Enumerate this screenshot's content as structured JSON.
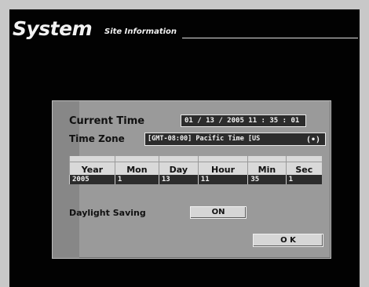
{
  "header": {
    "title": "System",
    "subtitle": "Site Information"
  },
  "dialog": {
    "current_time_label": "Current Time",
    "current_time_value": "01 / 13 / 2005  11 : 35 : 01",
    "time_zone_label": "Time Zone",
    "time_zone_value": "[GMT-08:00] Pacific Time [US",
    "time_zone_selector_icon": "(•)",
    "time_grid": {
      "headers": [
        "Year",
        "Mon",
        "Day",
        "Hour",
        "Min",
        "Sec"
      ],
      "values": [
        "2005",
        "1",
        "13",
        "11",
        "35",
        "1"
      ]
    },
    "daylight_label": "Daylight Saving",
    "daylight_value": "ON",
    "ok_label": "O K"
  }
}
